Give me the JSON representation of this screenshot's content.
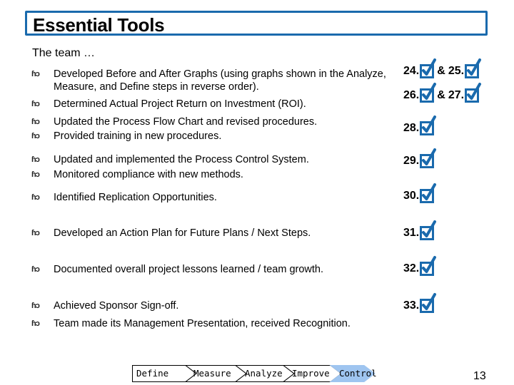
{
  "header": {
    "title": "Essential Tools"
  },
  "subtitle": "The team …",
  "bullet_glyph": "ɦɔ",
  "bullets": [
    {
      "text": "Developed Before and After Graphs (using graphs shown in the Analyze, Measure, and Define steps in reverse order)."
    },
    {
      "text": "Determined Actual Project Return on Investment (ROI)."
    },
    {
      "text": "Updated the Process Flow Chart and revised procedures."
    },
    {
      "text": "Provided training in new procedures."
    },
    {
      "text": "Updated and implemented the Process Control System."
    },
    {
      "text": "Monitored compliance with new methods."
    },
    {
      "text": "Identified Replication Opportunities."
    },
    {
      "text": "Developed an Action Plan for Future Plans / Next Steps."
    },
    {
      "text": "Documented overall project lessons learned / team growth."
    },
    {
      "text": "Achieved Sponsor Sign-off."
    },
    {
      "text": "Team made its Management Presentation, received Recognition."
    }
  ],
  "checklist": [
    {
      "first": "24.",
      "amp": "&",
      "second": "25.",
      "checked": true
    },
    {
      "first": "26.",
      "amp": "&",
      "second": "27.",
      "checked": true
    },
    {
      "first": "28.",
      "checked": true
    },
    {
      "first": "29.",
      "checked": true
    },
    {
      "first": "30.",
      "checked": true
    },
    {
      "first": "31.",
      "checked": true
    },
    {
      "first": "32.",
      "checked": true
    },
    {
      "first": "33.",
      "checked": true
    }
  ],
  "process": {
    "steps": [
      "Define",
      "Measure",
      "Analyze",
      "Improve",
      "Control"
    ],
    "active": "Control",
    "active_color": "#9fc5f0"
  },
  "colors": {
    "accent": "#1a6aad"
  },
  "page_number": "13"
}
